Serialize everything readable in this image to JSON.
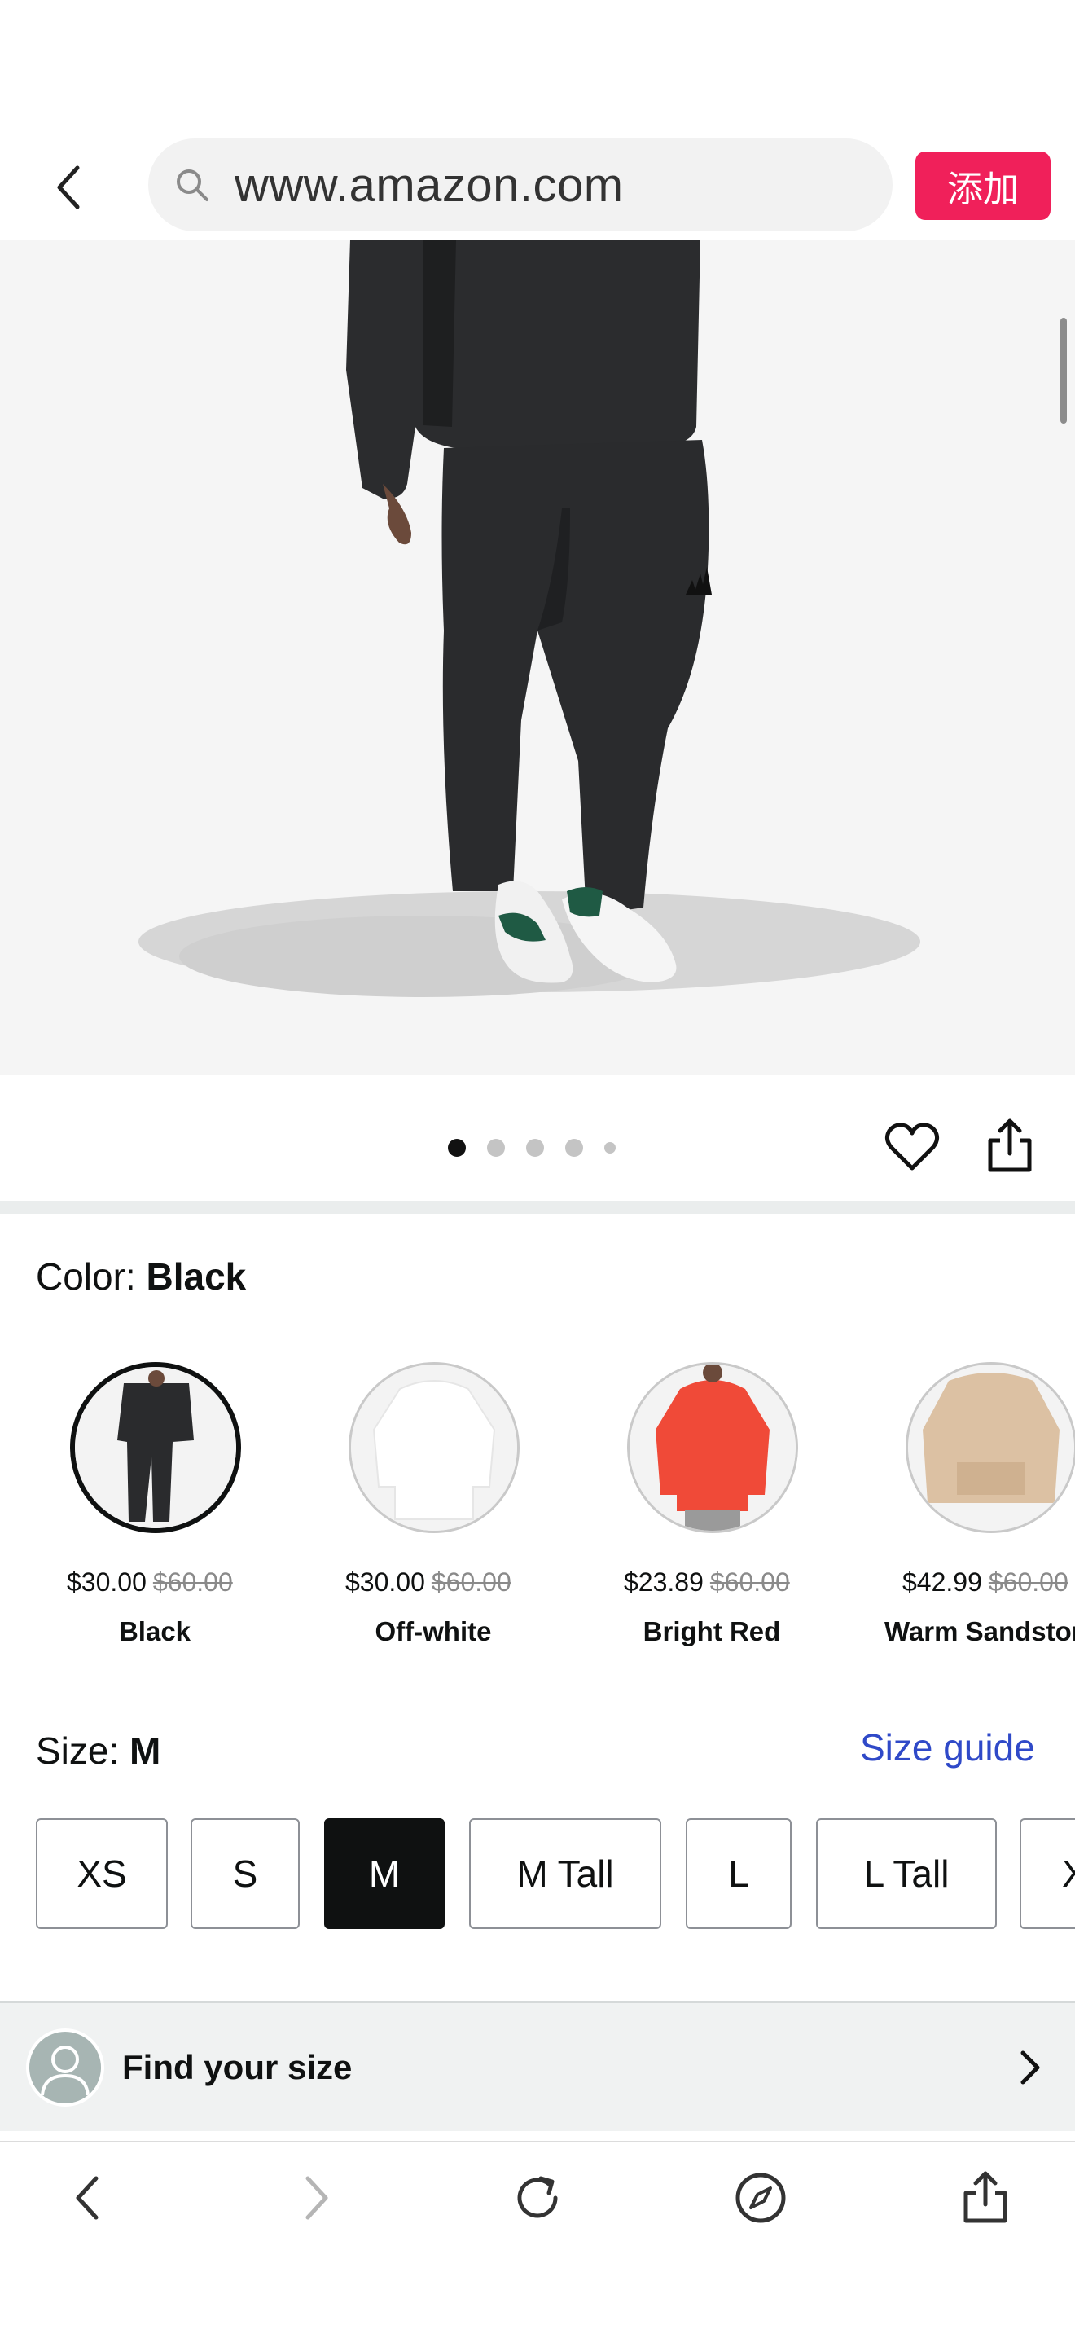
{
  "address_bar": {
    "url": "www.amazon.com",
    "add_button_label": "添加"
  },
  "gallery": {
    "dot_count": 5,
    "active_index": 0
  },
  "color": {
    "label": "Color: ",
    "selected": "Black",
    "options": [
      {
        "name": "Black",
        "price": "$30.00",
        "list_price": "$60.00",
        "selected": true
      },
      {
        "name": "Off-white",
        "price": "$30.00",
        "list_price": "$60.00",
        "selected": false
      },
      {
        "name": "Bright Red",
        "price": "$23.89",
        "list_price": "$60.00",
        "selected": false
      },
      {
        "name": "Warm Sandstor",
        "price": "$42.99",
        "list_price": "$60.00",
        "selected": false
      }
    ]
  },
  "size": {
    "label": "Size: ",
    "selected": "M",
    "guide_link": "Size guide",
    "options": [
      "XS",
      "S",
      "M",
      "M Tall",
      "L",
      "L Tall",
      "X"
    ]
  },
  "find_size": {
    "label": "Find your size"
  },
  "colors": {
    "accent_pink": "#f0205a",
    "link_blue": "#2f49c8",
    "selected_dark": "#0f1111"
  }
}
